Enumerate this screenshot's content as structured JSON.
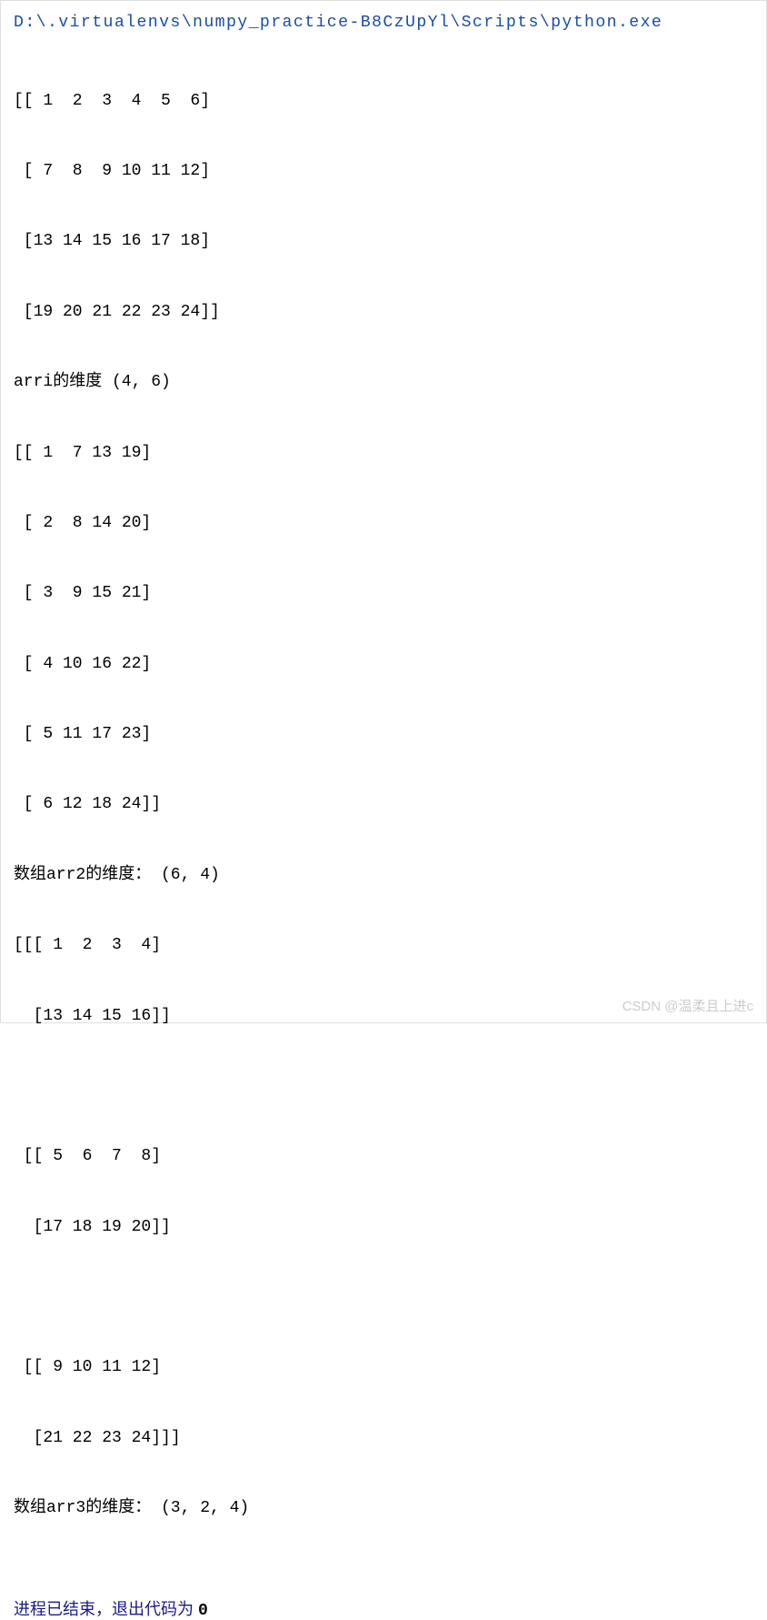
{
  "header": {
    "path": "D:\\.virtualenvs\\numpy_practice-B8CzUpYl\\Scripts\\python.exe"
  },
  "output": {
    "arr1_line1": "[[ 1  2  3  4  5  6]",
    "arr1_line2": " [ 7  8  9 10 11 12]",
    "arr1_line3": " [13 14 15 16 17 18]",
    "arr1_line4": " [19 20 21 22 23 24]]",
    "arr1_shape": "arri的维度 (4, 6)",
    "arr2_line1": "[[ 1  7 13 19]",
    "arr2_line2": " [ 2  8 14 20]",
    "arr2_line3": " [ 3  9 15 21]",
    "arr2_line4": " [ 4 10 16 22]",
    "arr2_line5": " [ 5 11 17 23]",
    "arr2_line6": " [ 6 12 18 24]]",
    "arr2_shape": "数组arr2的维度： (6, 4)",
    "arr3_line1": "[[[ 1  2  3  4]",
    "arr3_line2": "  [13 14 15 16]]",
    "arr3_blank1": "",
    "arr3_line3": " [[ 5  6  7  8]",
    "arr3_line4": "  [17 18 19 20]]",
    "arr3_blank2": "",
    "arr3_line5": " [[ 9 10 11 12]",
    "arr3_line6": "  [21 22 23 24]]]",
    "arr3_shape": "数组arr3的维度： (3, 2, 4)"
  },
  "process": {
    "text_prefix": "进程已结束，退出代码为 ",
    "code": "0"
  },
  "watermark": "CSDN @温柔且上进c"
}
